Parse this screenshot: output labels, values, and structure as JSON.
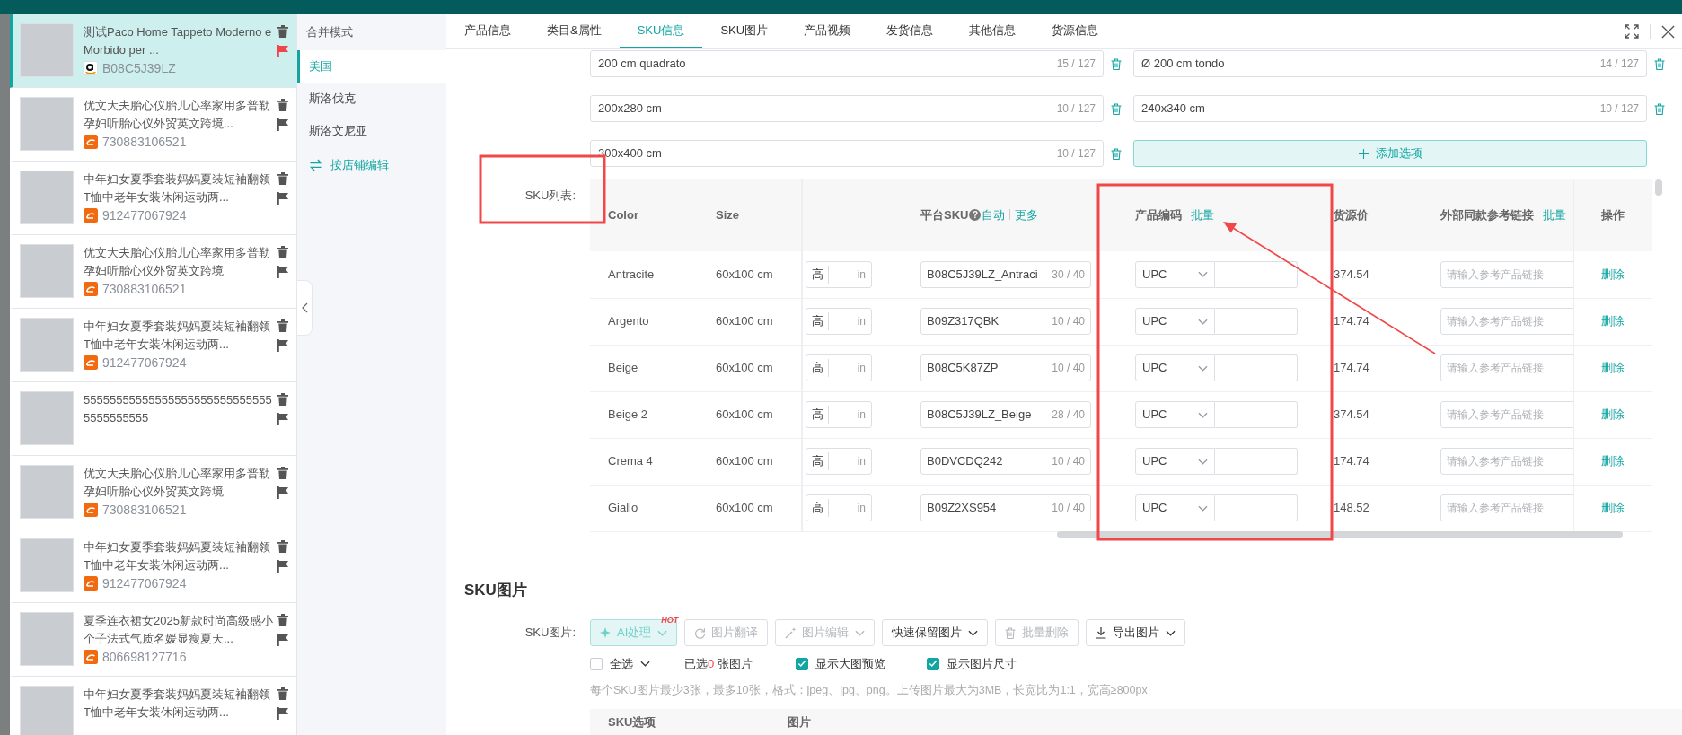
{
  "products": [
    {
      "title": "测试Paco Home Tappeto Moderno e Morbido per ...",
      "kind": "smile",
      "id": "B08C5J39LZ",
      "selected": true,
      "flagged": true
    },
    {
      "title": "优文大夫胎心仪胎儿心率家用多普勒孕妇听胎心仪外贸英文跨境...",
      "kind": "swirl",
      "id": "730883106521",
      "selected": false,
      "flagged": false
    },
    {
      "title": "中年妇女夏季套装妈妈夏装短袖翻领T恤中老年女装休闲运动两...",
      "kind": "swirl",
      "id": "912477067924",
      "selected": false,
      "flagged": false
    },
    {
      "title": "优文大夫胎心仪胎儿心率家用多普勒孕妇听胎心仪外贸英文跨境",
      "kind": "swirl",
      "id": "730883106521",
      "selected": false,
      "flagged": false
    },
    {
      "title": "中年妇女夏季套装妈妈夏装短袖翻领T恤中老年女装休闲运动两...",
      "kind": "swirl",
      "id": "912477067924",
      "selected": false,
      "flagged": false
    },
    {
      "title": "555555555555555555555555555555555555555",
      "selected": false,
      "flagged": false
    },
    {
      "title": "优文大夫胎心仪胎儿心率家用多普勒孕妇听胎心仪外贸英文跨境",
      "kind": "swirl",
      "id": "730883106521",
      "selected": false,
      "flagged": false
    },
    {
      "title": "中年妇女夏季套装妈妈夏装短袖翻领T恤中老年女装休闲运动两...",
      "kind": "swirl",
      "id": "912477067924",
      "selected": false,
      "flagged": false
    },
    {
      "title": "夏季连衣裙女2025新款时尚高级感小个子法式气质名媛显瘦夏天...",
      "kind": "swirl",
      "id": "806698127716",
      "selected": false,
      "flagged": false
    },
    {
      "title": "中年妇女夏季套装妈妈夏装短袖翻领T恤中老年女装休闲运动两...",
      "selected": false,
      "flagged": false
    }
  ],
  "regions": {
    "title": "合并模式",
    "items": [
      {
        "label": "美国",
        "selected": true
      },
      {
        "label": "斯洛伐克",
        "selected": false
      },
      {
        "label": "斯洛文尼亚",
        "selected": false
      }
    ],
    "edit_link": "按店铺编辑"
  },
  "tabs": [
    {
      "label": "产品信息",
      "selected": false
    },
    {
      "label": "类目&属性",
      "selected": false
    },
    {
      "label": "SKU信息",
      "selected": true
    },
    {
      "label": "SKU图片",
      "selected": false
    },
    {
      "label": "产品视频",
      "selected": false
    },
    {
      "label": "发货信息",
      "selected": false
    },
    {
      "label": "其他信息",
      "selected": false
    },
    {
      "label": "货源信息",
      "selected": false
    }
  ],
  "options": [
    {
      "value": "200 cm quadrato",
      "count": "15 / 127"
    },
    {
      "value": "Ø 200 cm tondo",
      "count": "14 / 127"
    },
    {
      "value": "200x280 cm",
      "count": "10 / 127"
    },
    {
      "value": "240x340 cm",
      "count": "10 / 127"
    },
    {
      "value": "300x400 cm",
      "count": "10 / 127"
    }
  ],
  "add_option": "添加选项",
  "sku_list": {
    "label": "SKU列表:",
    "columns": {
      "color_header": "Color",
      "size": "Size",
      "platform_sku": "平台SKU",
      "help": "?",
      "auto": "自动",
      "more": "更多",
      "code": "产品编码",
      "code_batch": "批量",
      "price": "货源价",
      "link": "外部同款参考链接",
      "link_batch": "批量",
      "action": "操作"
    },
    "rows": [
      {
        "color_name": "Antracite",
        "size": "60x100 cm",
        "height_prefix": "高",
        "unit": "in",
        "sku": "B08C5J39LZ_Antraci",
        "sku_count": "30 / 40",
        "code_type": "UPC",
        "price": "374.54",
        "link_placeholder": "请输入参考产品链接",
        "action": "删除"
      },
      {
        "color_name": "Argento",
        "size": "60x100 cm",
        "height_prefix": "高",
        "unit": "in",
        "sku": "B09Z317QBK",
        "sku_count": "10 / 40",
        "code_type": "UPC",
        "price": "174.74",
        "link_placeholder": "请输入参考产品链接",
        "action": "删除"
      },
      {
        "color_name": "Beige",
        "size": "60x100 cm",
        "height_prefix": "高",
        "unit": "in",
        "sku": "B08C5K87ZP",
        "sku_count": "10 / 40",
        "code_type": "UPC",
        "price": "174.74",
        "link_placeholder": "请输入参考产品链接",
        "action": "删除"
      },
      {
        "color_name": "Beige 2",
        "size": "60x100 cm",
        "height_prefix": "高",
        "unit": "in",
        "sku": "B08C5J39LZ_Beige",
        "sku_count": "28 / 40",
        "code_type": "UPC",
        "price": "374.54",
        "link_placeholder": "请输入参考产品链接",
        "action": "删除"
      },
      {
        "color_name": "Crema 4",
        "size": "60x100 cm",
        "height_prefix": "高",
        "unit": "in",
        "sku": "B0DVCDQ242",
        "sku_count": "10 / 40",
        "code_type": "UPC",
        "price": "174.74",
        "link_placeholder": "请输入参考产品链接",
        "action": "删除"
      },
      {
        "color_name": "Giallo",
        "size": "60x100 cm",
        "height_prefix": "高",
        "unit": "in",
        "sku": "B09Z2XS954",
        "sku_count": "10 / 40",
        "code_type": "UPC",
        "price": "148.52",
        "link_placeholder": "请输入参考产品链接",
        "action": "删除"
      }
    ]
  },
  "sku_images": {
    "title": "SKU图片",
    "label": "SKU图片:",
    "buttons": [
      {
        "kind": "ai",
        "label": "AI处理",
        "badge": "HOT",
        "dropdown": true,
        "disabled": false
      },
      {
        "kind": "translate",
        "label": "图片翻译",
        "dropdown": false,
        "disabled": true
      },
      {
        "kind": "edit",
        "label": "图片编辑",
        "dropdown": true,
        "disabled": true
      },
      {
        "kind": "keep",
        "label": "快速保留图片",
        "dropdown": true,
        "disabled": false
      },
      {
        "kind": "delete",
        "label": "批量删除",
        "dropdown": false,
        "disabled": true
      },
      {
        "kind": "export",
        "label": "导出图片",
        "dropdown": true,
        "disabled": false
      }
    ],
    "select_all": {
      "label": "全选",
      "checked": false
    },
    "selected": {
      "prefix": "已选",
      "count": "0",
      "suffix": " 张图片"
    },
    "toggles": [
      {
        "label": "显示大图预览",
        "checked": true
      },
      {
        "label": "显示图片尺寸",
        "checked": true
      }
    ],
    "hint": "每个SKU图片最少3张，最多10张，格式：jpeg、jpg、png。上传图片最大为3MB，长宽比为1:1，宽高≥800px",
    "columns": [
      "SKU选项",
      "图片"
    ]
  }
}
